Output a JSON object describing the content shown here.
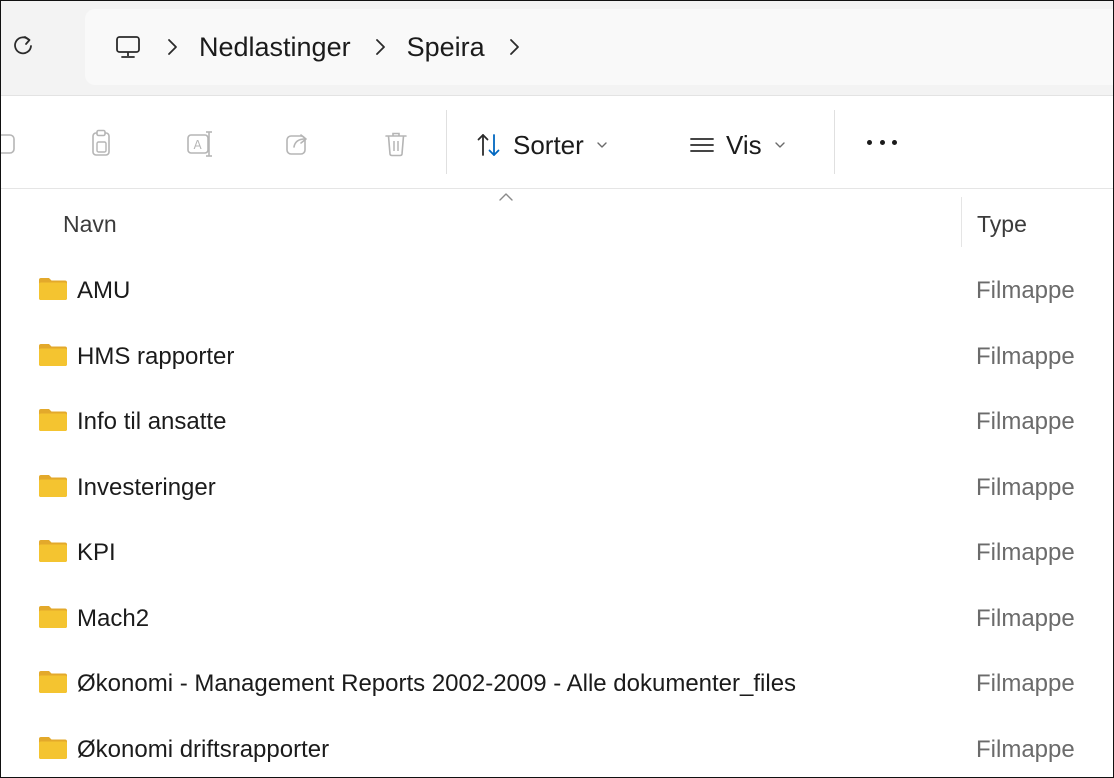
{
  "address_bar": {
    "refresh_icon": "refresh-icon",
    "root_icon": "this-pc-icon",
    "breadcrumbs": [
      "Nedlastinger",
      "Speira"
    ]
  },
  "command_bar": {
    "tools": [
      "cut-icon",
      "copy-icon",
      "rename-icon",
      "share-icon",
      "delete-icon"
    ],
    "sort_label": "Sorter",
    "view_label": "Vis",
    "more_icon": "more-icon"
  },
  "columns": {
    "name": "Navn",
    "type": "Type"
  },
  "colors": {
    "folder": "#f4c430",
    "folder_dark": "#e3a92b",
    "accent": "#0067c0"
  },
  "files": [
    {
      "name": "AMU",
      "type": "Filmappe"
    },
    {
      "name": "HMS rapporter",
      "type": "Filmappe"
    },
    {
      "name": "Info til ansatte",
      "type": "Filmappe"
    },
    {
      "name": "Investeringer",
      "type": "Filmappe"
    },
    {
      "name": "KPI",
      "type": "Filmappe"
    },
    {
      "name": "Mach2",
      "type": "Filmappe"
    },
    {
      "name": "Økonomi - Management Reports 2002-2009 - Alle dokumenter_files",
      "type": "Filmappe"
    },
    {
      "name": "Økonomi driftsrapporter",
      "type": "Filmappe"
    }
  ]
}
